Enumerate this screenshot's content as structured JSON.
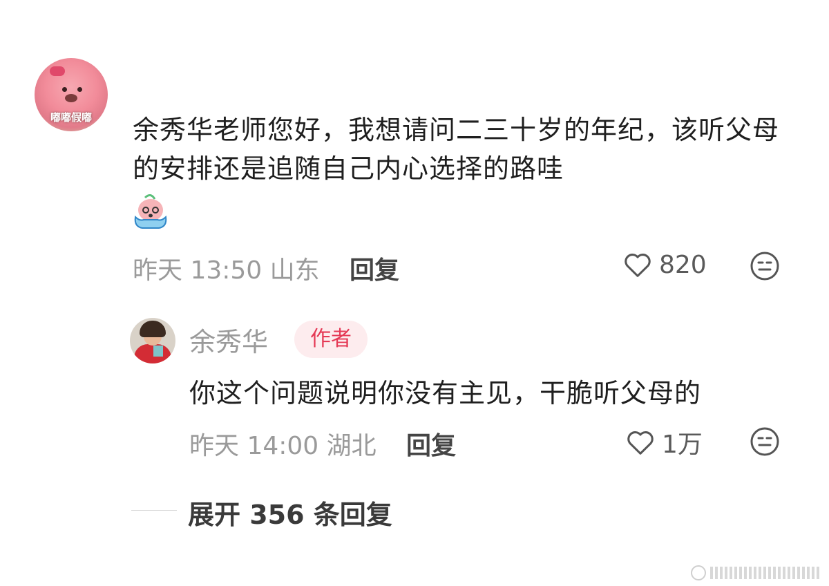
{
  "comment": {
    "avatar_label": "嘟嘟假嘟",
    "text": "余秀华老师您好，我想请问二三十岁的年纪，该听父母的安排还是追随自己内心选择的路哇",
    "time": "昨天 13:50",
    "location": "山东",
    "reply_label": "回复",
    "likes": "820",
    "icons": [
      "heart-icon",
      "dislike-face-icon",
      "cry-sticker-icon"
    ]
  },
  "reply": {
    "author": "余秀华",
    "badge": "作者",
    "text": "你这个问题说明你没有主见，干脆听父母的",
    "time": "昨天 14:00",
    "location": "湖北",
    "reply_label": "回复",
    "likes": "1万"
  },
  "expand": {
    "label": "展开 356 条回复"
  },
  "colors": {
    "text": "#1f1f1f",
    "meta": "#9a9a9a",
    "badge_bg": "#fdecee",
    "badge_text": "#e53955"
  }
}
